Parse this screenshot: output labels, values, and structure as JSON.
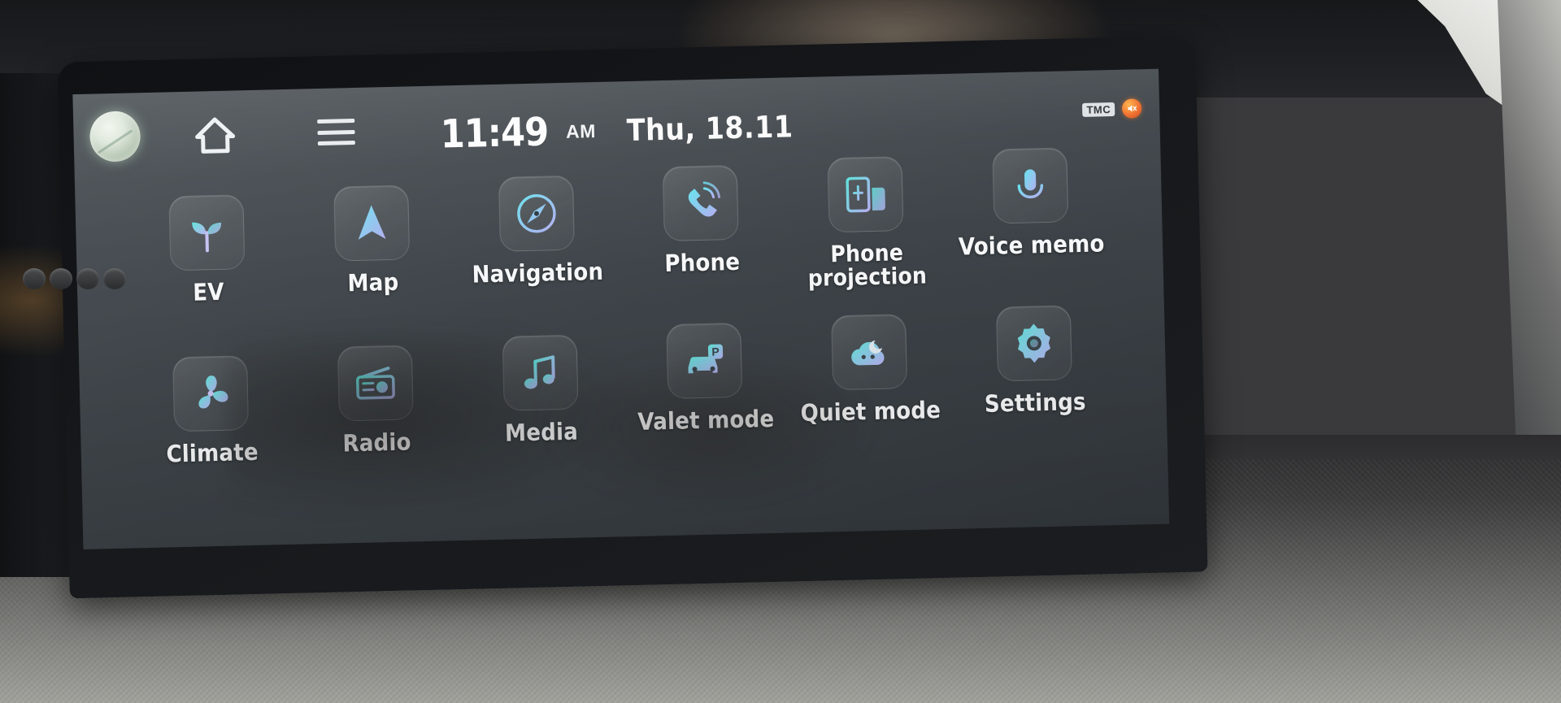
{
  "statusbar": {
    "lens_icon": "circular-lens-glare",
    "home_icon": "home-icon",
    "menu_icon": "hamburger-menu-icon",
    "time": "11:49",
    "ampm": "AM",
    "date": "Thu, 18.11",
    "tmc_badge": "TMC",
    "alert_icon": "muted-speaker-icon"
  },
  "apps": {
    "row1": [
      {
        "label": "EV",
        "icon": "sprout-icon",
        "two_line": false
      },
      {
        "label": "Map",
        "icon": "navigation-arrow-icon",
        "two_line": false
      },
      {
        "label": "Navigation",
        "icon": "compass-needle-icon",
        "two_line": false
      },
      {
        "label": "Phone",
        "icon": "phone-handset-icon",
        "two_line": false
      },
      {
        "label": "Phone\nprojection",
        "icon": "phone-projection-icon",
        "two_line": true
      },
      {
        "label": "Voice memo",
        "icon": "microphone-icon",
        "two_line": false
      }
    ],
    "row2": [
      {
        "label": "Climate",
        "icon": "fan-icon",
        "two_line": false
      },
      {
        "label": "Radio",
        "icon": "radio-icon",
        "two_line": false
      },
      {
        "label": "Media",
        "icon": "music-note-icon",
        "two_line": false
      },
      {
        "label": "Valet mode",
        "icon": "valet-car-parking-icon",
        "two_line": false
      },
      {
        "label": "Quiet mode",
        "icon": "cloud-moon-icon",
        "two_line": false
      },
      {
        "label": "Settings",
        "icon": "gear-icon",
        "two_line": false
      }
    ]
  },
  "colors": {
    "accent_cyan": "#5de0e6",
    "accent_lavender": "#b7b2ef",
    "screen_bg": "#3e4449",
    "text": "#f6f7f8",
    "alert_orange": "#ef6d2a"
  }
}
